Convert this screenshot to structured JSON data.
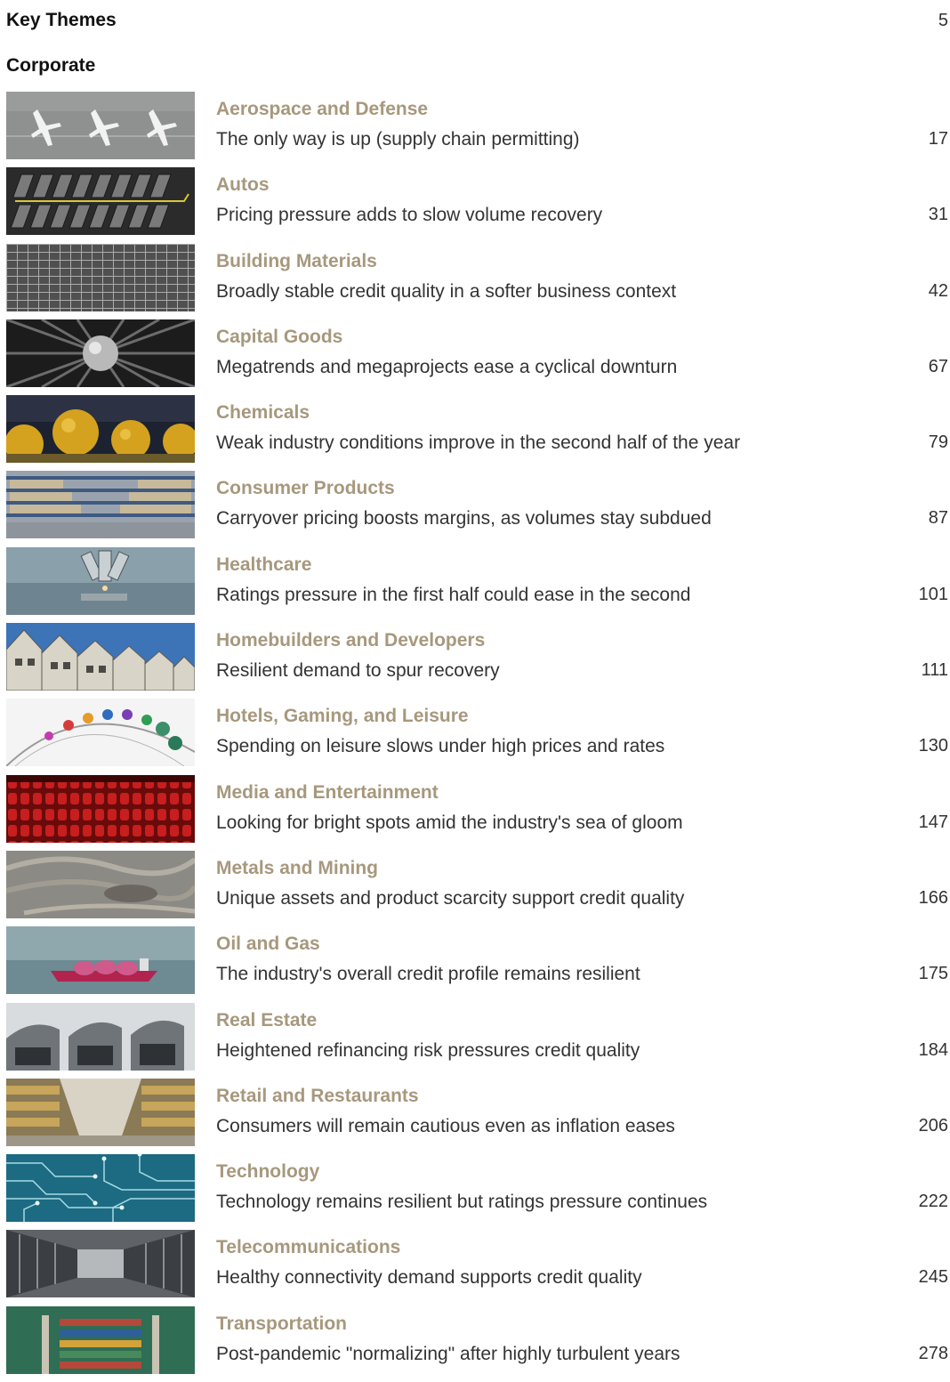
{
  "key_themes": {
    "label": "Key Themes",
    "page": "5"
  },
  "section": {
    "label": "Corporate"
  },
  "entries": [
    {
      "title": "Aerospace and Defense",
      "subtitle": "The only way is up (supply chain permitting)",
      "page": "17"
    },
    {
      "title": "Autos",
      "subtitle": "Pricing pressure adds to slow volume recovery",
      "page": "31"
    },
    {
      "title": "Building Materials",
      "subtitle": "Broadly stable credit quality in a softer business context",
      "page": "42"
    },
    {
      "title": "Capital Goods",
      "subtitle": "Megatrends and megaprojects ease a cyclical downturn",
      "page": "67"
    },
    {
      "title": "Chemicals",
      "subtitle": "Weak industry conditions improve in the second half of the year",
      "page": "79"
    },
    {
      "title": "Consumer Products",
      "subtitle": "Carryover pricing boosts margins, as volumes stay subdued",
      "page": "87"
    },
    {
      "title": "Healthcare",
      "subtitle": "Ratings pressure in the first half could ease in the second",
      "page": "101"
    },
    {
      "title": "Homebuilders and Developers",
      "subtitle": "Resilient demand to spur recovery",
      "page": "111"
    },
    {
      "title": "Hotels, Gaming, and Leisure",
      "subtitle": "Spending on leisure slows under high prices and rates",
      "page": "130"
    },
    {
      "title": "Media and Entertainment",
      "subtitle": "Looking for bright spots amid the industry's sea of gloom",
      "page": "147"
    },
    {
      "title": "Metals and Mining",
      "subtitle": "Unique assets and product scarcity support credit quality",
      "page": "166"
    },
    {
      "title": "Oil and Gas",
      "subtitle": "The industry's overall credit profile remains resilient",
      "page": "175"
    },
    {
      "title": "Real Estate",
      "subtitle": "Heightened refinancing risk pressures credit quality",
      "page": "184"
    },
    {
      "title": "Retail and Restaurants",
      "subtitle": "Consumers will remain cautious even as inflation eases",
      "page": "206"
    },
    {
      "title": "Technology",
      "subtitle": "Technology remains resilient but ratings pressure continues",
      "page": "222"
    },
    {
      "title": "Telecommunications",
      "subtitle": "Healthy connectivity demand supports credit quality",
      "page": "245"
    },
    {
      "title": "Transportation",
      "subtitle": "Post-pandemic \"normalizing\" after highly turbulent years",
      "page": "278"
    }
  ]
}
